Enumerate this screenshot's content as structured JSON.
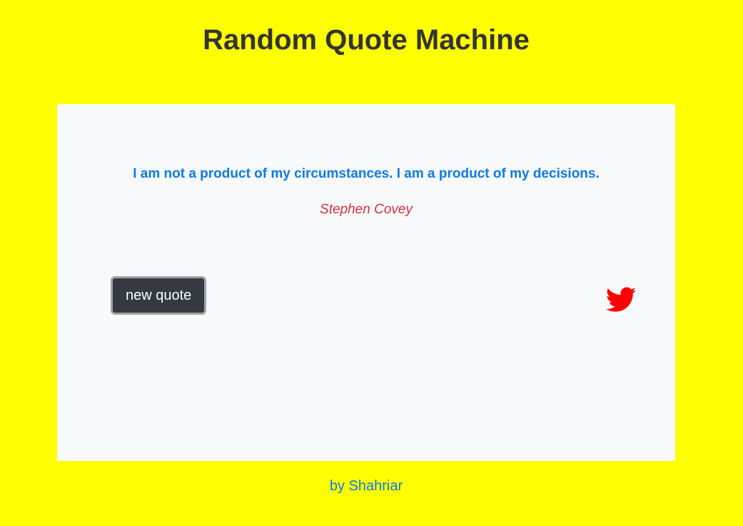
{
  "header": {
    "title": "Random Quote Machine"
  },
  "quote": {
    "text": "I am not a product of my circumstances. I am a product of my decisions.",
    "author": "Stephen Covey"
  },
  "actions": {
    "new_quote_label": "new quote",
    "tweet_icon": "twitter-bird-icon"
  },
  "footer": {
    "credit": "by Shahriar"
  },
  "colors": {
    "background": "#ffff00",
    "card": "#f8f9fa",
    "quote_text": "#0d7ae8",
    "author_text": "#d0313f",
    "button": "#343a40",
    "twitter_icon": "#ff0000"
  }
}
